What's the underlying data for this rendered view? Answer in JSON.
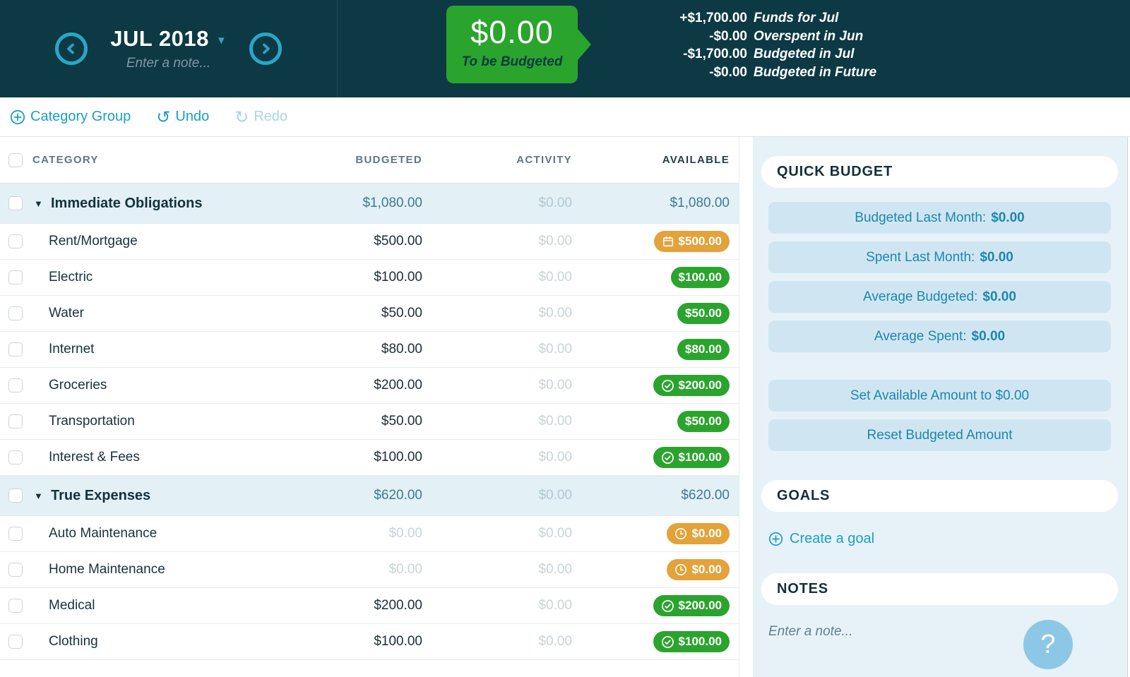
{
  "header": {
    "month": "JUL 2018",
    "note_placeholder": "Enter a note...",
    "to_be_budgeted": {
      "amount": "$0.00",
      "label": "To be Budgeted"
    },
    "breakdown": [
      {
        "amount": "+$1,700.00",
        "label": "Funds for Jul"
      },
      {
        "amount": "-$0.00",
        "label": "Overspent in Jun"
      },
      {
        "amount": "-$1,700.00",
        "label": "Budgeted in Jul"
      },
      {
        "amount": "-$0.00",
        "label": "Budgeted in Future"
      }
    ]
  },
  "toolbar": {
    "category_group": "Category Group",
    "undo": "Undo",
    "redo": "Redo"
  },
  "table": {
    "columns": {
      "category": "CATEGORY",
      "budgeted": "BUDGETED",
      "activity": "ACTIVITY",
      "available": "AVAILABLE"
    },
    "rows": [
      {
        "type": "group",
        "name": "Immediate Obligations",
        "budgeted": "$1,080.00",
        "activity": "$0.00",
        "available": "$1,080.00",
        "badge": "",
        "badge_icon": "",
        "muted_budgeted": false
      },
      {
        "type": "category",
        "name": "Rent/Mortgage",
        "budgeted": "$500.00",
        "activity": "$0.00",
        "available": "$500.00",
        "badge": "warning",
        "badge_icon": "calendar",
        "muted_budgeted": false
      },
      {
        "type": "category",
        "name": "Electric",
        "budgeted": "$100.00",
        "activity": "$0.00",
        "available": "$100.00",
        "badge": "success",
        "badge_icon": "",
        "muted_budgeted": false
      },
      {
        "type": "category",
        "name": "Water",
        "budgeted": "$50.00",
        "activity": "$0.00",
        "available": "$50.00",
        "badge": "success",
        "badge_icon": "",
        "muted_budgeted": false
      },
      {
        "type": "category",
        "name": "Internet",
        "budgeted": "$80.00",
        "activity": "$0.00",
        "available": "$80.00",
        "badge": "success",
        "badge_icon": "",
        "muted_budgeted": false
      },
      {
        "type": "category",
        "name": "Groceries",
        "budgeted": "$200.00",
        "activity": "$0.00",
        "available": "$200.00",
        "badge": "success",
        "badge_icon": "check",
        "muted_budgeted": false
      },
      {
        "type": "category",
        "name": "Transportation",
        "budgeted": "$50.00",
        "activity": "$0.00",
        "available": "$50.00",
        "badge": "success",
        "badge_icon": "",
        "muted_budgeted": false
      },
      {
        "type": "category",
        "name": "Interest & Fees",
        "budgeted": "$100.00",
        "activity": "$0.00",
        "available": "$100.00",
        "badge": "success",
        "badge_icon": "check",
        "muted_budgeted": false
      },
      {
        "type": "group",
        "name": "True Expenses",
        "budgeted": "$620.00",
        "activity": "$0.00",
        "available": "$620.00",
        "badge": "",
        "badge_icon": "",
        "muted_budgeted": false
      },
      {
        "type": "category",
        "name": "Auto Maintenance",
        "budgeted": "$0.00",
        "activity": "$0.00",
        "available": "$0.00",
        "badge": "warning",
        "badge_icon": "clock",
        "muted_budgeted": true
      },
      {
        "type": "category",
        "name": "Home Maintenance",
        "budgeted": "$0.00",
        "activity": "$0.00",
        "available": "$0.00",
        "badge": "warning",
        "badge_icon": "clock",
        "muted_budgeted": true
      },
      {
        "type": "category",
        "name": "Medical",
        "budgeted": "$200.00",
        "activity": "$0.00",
        "available": "$200.00",
        "badge": "success",
        "badge_icon": "check",
        "muted_budgeted": false
      },
      {
        "type": "category",
        "name": "Clothing",
        "budgeted": "$100.00",
        "activity": "$0.00",
        "available": "$100.00",
        "badge": "success",
        "badge_icon": "check",
        "muted_budgeted": false
      }
    ]
  },
  "inspector": {
    "quick_budget_title": "QUICK BUDGET",
    "quick_buttons": [
      {
        "label": "Budgeted Last Month:",
        "value": "$0.00"
      },
      {
        "label": "Spent Last Month:",
        "value": "$0.00"
      },
      {
        "label": "Average Budgeted:",
        "value": "$0.00"
      },
      {
        "label": "Average Spent:",
        "value": "$0.00"
      }
    ],
    "action_buttons": [
      {
        "label": "Set Available Amount to $0.00"
      },
      {
        "label": "Reset Budgeted Amount"
      }
    ],
    "goals_title": "GOALS",
    "create_goal_label": "Create a goal",
    "notes_title": "NOTES",
    "notes_placeholder": "Enter a note...",
    "help_label": "?"
  },
  "colors": {
    "header_bg": "#0c3944",
    "accent_teal": "#1b9fc3",
    "success_green": "#2aa42d",
    "warning_orange": "#e3a23a",
    "group_row_bg": "#e3f0f6",
    "inspector_bg": "#e7f2f8",
    "inspector_button_bg": "#cfe6f2",
    "muted_value": "#c9d3d7"
  }
}
